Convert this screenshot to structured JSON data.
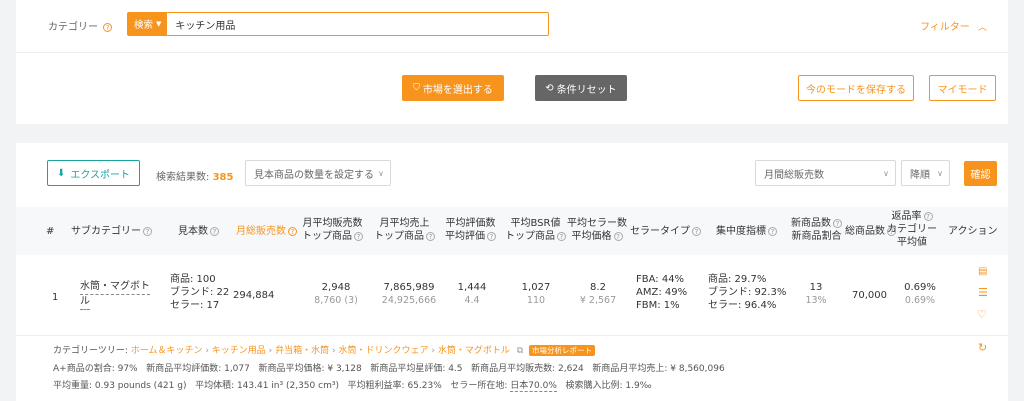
{
  "filter": {
    "category_label": "カテゴリー",
    "search_tag": "検索",
    "search_value": "キッチン用品",
    "filter_toggle": "フィルター",
    "select_market_button": "市場を選出する",
    "reset_button": "条件リセット",
    "save_mode_button": "今のモードを保存する",
    "my_mode_button": "マイモード"
  },
  "toolbar": {
    "export_button": "エクスポート",
    "result_label": "検索結果数:",
    "result_count": "385",
    "item_count_select": "見本商品の数量を設定する",
    "sort_field_select": "月間総販売数",
    "sort_order_select": "降順",
    "confirm_button": "確認"
  },
  "columns": {
    "index": "#",
    "subcategory": "サブカテゴリー",
    "sample_count": "見本数",
    "monthly_sales": "月総販売数",
    "avg_sales_l1": "月平均販売数",
    "avg_sales_l2": "トップ商品",
    "avg_revenue_l1": "月平均売上",
    "avg_revenue_l2": "トップ商品",
    "avg_reviews_l1": "平均評価数",
    "avg_reviews_l2": "平均評価",
    "avg_bsr_l1": "平均BSR値",
    "avg_bsr_l2": "トップ商品",
    "avg_sellers_l1": "平均セラー数",
    "avg_sellers_l2": "平均価格",
    "seller_type": "セラータイプ",
    "concentration": "集中度指標",
    "new_items_l1": "新商品数",
    "new_items_l2": "新商品割合",
    "total_items": "総商品数",
    "return_l1": "返品率",
    "return_l2": "カテゴリー",
    "return_l3": "平均値",
    "action": "アクション"
  },
  "row": {
    "index": "1",
    "subcategory_l1": "水筒・マグボト",
    "subcategory_l2": "ル",
    "sample_products": "商品: 100",
    "sample_brands": "ブランド: 22",
    "sample_sellers": "セラー: 17",
    "monthly_sales": "294,884",
    "avg_sales": "2,948",
    "avg_sales_top": "8,760 (3)",
    "avg_revenue": "7,865,989",
    "avg_revenue_top": "24,925,666",
    "avg_reviews": "1,444",
    "avg_rating": "4.4",
    "avg_bsr": "1,027",
    "avg_bsr_top": "110",
    "avg_sellers": "8.2",
    "avg_price": "¥ 2,567",
    "fba": "FBA: 44%",
    "amz": "AMZ: 49%",
    "fbm": "FBM: 1%",
    "conc_products": "商品: 29.7%",
    "conc_brands": "ブランド: 92.3%",
    "conc_sellers": "セラー: 96.4%",
    "new_items": "13",
    "new_items_ratio": "13%",
    "total_items": "70,000",
    "return_rate": "0.69%",
    "return_cat_avg": "0.69%"
  },
  "details": {
    "tree_label": "カテゴリーツリー:",
    "tree_path": [
      "ホーム＆キッチン",
      "キッチン用品",
      "弁当箱・水筒",
      "水筒・ドリンクウェア",
      "水筒・マグボトル"
    ],
    "report_badge": "市場分析レポート",
    "line2": [
      "A+商品の割合: 97%",
      "新商品平均評価数: 1,077",
      "新商品平均価格: ¥ 3,128",
      "新商品平均星評価: 4.5",
      "新商品月平均販売数: 2,624",
      "新商品月平均売上: ¥ 8,560,096"
    ],
    "line3_a": "平均重量: 0.93 pounds (421 g)",
    "line3_b": "平均体積: 143.41 in³ (2,350 cm³)",
    "line3_c": "平均粗利益率: 65.23%",
    "line3_d_label": "セラー所在地:",
    "line3_d_value": "日本70.0%",
    "line3_e": "検索購入比例: 1.9‰"
  },
  "colors": {
    "accent": "#f7941d",
    "teal": "#19a3a3",
    "grey_button": "#666666"
  }
}
